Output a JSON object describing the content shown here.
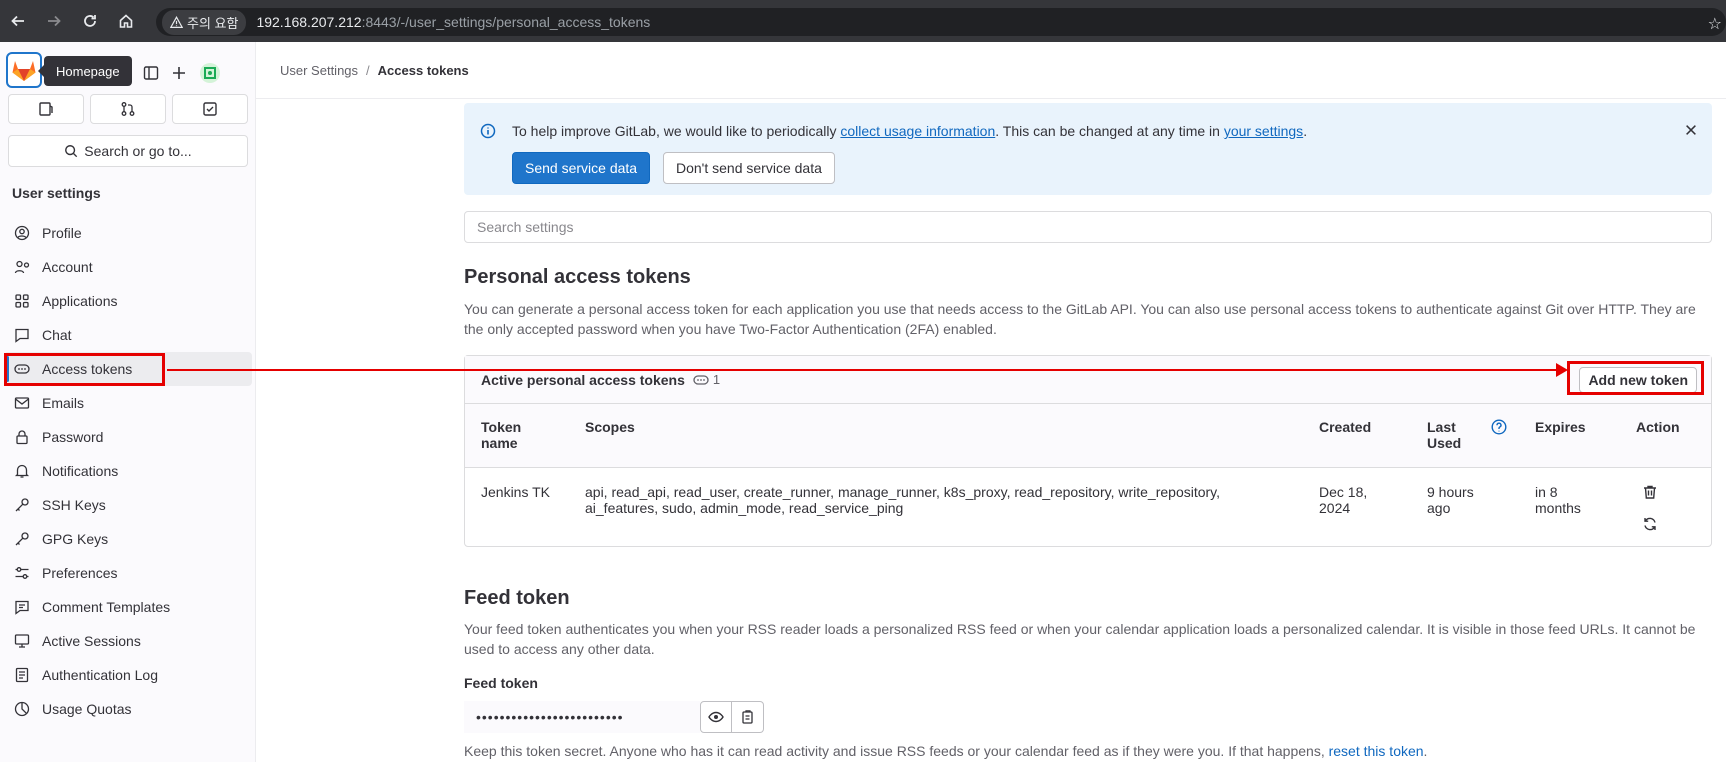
{
  "browser": {
    "security_label": "주의 요함",
    "url_host": "192.168.207.212",
    "url_rest": ":8443/-/user_settings/personal_access_tokens"
  },
  "sidebar": {
    "tooltip": "Homepage",
    "search_label": "Search or go to...",
    "heading": "User settings",
    "items": [
      {
        "label": "Profile",
        "icon": "profile-icon"
      },
      {
        "label": "Account",
        "icon": "account-icon"
      },
      {
        "label": "Applications",
        "icon": "applications-icon"
      },
      {
        "label": "Chat",
        "icon": "chat-icon"
      },
      {
        "label": "Access tokens",
        "icon": "token-icon",
        "active": true
      },
      {
        "label": "Emails",
        "icon": "mail-icon"
      },
      {
        "label": "Password",
        "icon": "lock-icon"
      },
      {
        "label": "Notifications",
        "icon": "bell-icon"
      },
      {
        "label": "SSH Keys",
        "icon": "key-icon"
      },
      {
        "label": "GPG Keys",
        "icon": "key-icon"
      },
      {
        "label": "Preferences",
        "icon": "preferences-icon"
      },
      {
        "label": "Comment Templates",
        "icon": "comment-icon"
      },
      {
        "label": "Active Sessions",
        "icon": "monitor-icon"
      },
      {
        "label": "Authentication Log",
        "icon": "log-icon"
      },
      {
        "label": "Usage Quotas",
        "icon": "quota-icon"
      }
    ]
  },
  "breadcrumb": {
    "parent": "User Settings",
    "separator": "/",
    "current": "Access tokens"
  },
  "banner": {
    "text_1": "To help improve GitLab, we would like to periodically ",
    "link_1": "collect usage information",
    "text_2": ". This can be changed at any time in ",
    "link_2": "your settings",
    "text_3": ".",
    "primary_button": "Send service data",
    "secondary_button": "Don't send service data"
  },
  "settings_search_placeholder": "Search settings",
  "pat": {
    "title": "Personal access tokens",
    "description": "You can generate a personal access token for each application you use that needs access to the GitLab API. You can also use personal access tokens to authenticate against Git over HTTP. They are the only accepted password when you have Two-Factor Authentication (2FA) enabled.",
    "card_title": "Active personal access tokens",
    "count": "1",
    "add_button": "Add new token",
    "columns": {
      "name": "Token name",
      "scopes": "Scopes",
      "created": "Created",
      "last_used": "Last Used",
      "expires": "Expires",
      "action": "Action"
    },
    "row": {
      "name": "Jenkins TK",
      "scopes": "api, read_api, read_user, create_runner, manage_runner, k8s_proxy, read_repository, write_repository, ai_features, sudo, admin_mode, read_service_ping",
      "created": "Dec 18, 2024",
      "last_used": "9 hours ago",
      "expires": "in 8 months"
    }
  },
  "feed": {
    "title": "Feed token",
    "description": "Your feed token authenticates you when your RSS reader loads a personalized RSS feed or when your calendar application loads a personalized calendar. It is visible in those feed URLs. It cannot be used to access any other data.",
    "label": "Feed token",
    "masked_value": "•••••••••••••••••••••••••",
    "note_text": "Keep this token secret. Anyone who has it can read activity and issue RSS feeds or your calendar feed as if they were you. If that happens, ",
    "note_link": "reset this token",
    "note_end": "."
  },
  "colors": {
    "accent": "#1f75cb",
    "annotation": "#e50000",
    "banner_bg": "#e9f3fc"
  }
}
